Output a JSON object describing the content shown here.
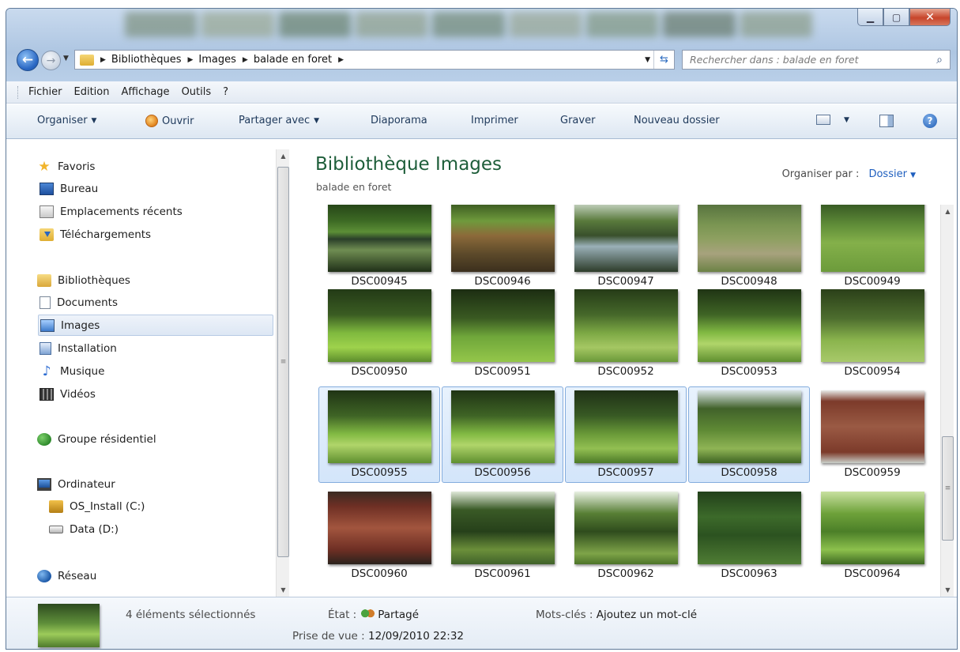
{
  "address": {
    "crumbs": [
      "Bibliothèques",
      "Images",
      "balade en foret"
    ],
    "search_placeholder": "Rechercher dans : balade en foret"
  },
  "menubar": [
    "Fichier",
    "Edition",
    "Affichage",
    "Outils",
    "?"
  ],
  "commandbar": {
    "organiser": "Organiser",
    "ouvrir": "Ouvrir",
    "partager": "Partager avec",
    "diaporama": "Diaporama",
    "imprimer": "Imprimer",
    "graver": "Graver",
    "nouveau_dossier": "Nouveau dossier"
  },
  "navpane": {
    "favoris": "Favoris",
    "bureau": "Bureau",
    "recents": "Emplacements récents",
    "telechargements": "Téléchargements",
    "bibliotheques": "Bibliothèques",
    "documents": "Documents",
    "images": "Images",
    "installation": "Installation",
    "musique": "Musique",
    "videos": "Vidéos",
    "groupe": "Groupe résidentiel",
    "ordinateur": "Ordinateur",
    "os_install": "OS_Install (C:)",
    "data": "Data (D:)",
    "reseau": "Réseau"
  },
  "content": {
    "title": "Bibliothèque Images",
    "subtitle": "balade en foret",
    "arrange_label": "Organiser par :",
    "arrange_value": "Dossier"
  },
  "thumbnails": [
    {
      "name": "DSC00945",
      "selected": false,
      "scene": "pond"
    },
    {
      "name": "DSC00946",
      "selected": false,
      "scene": "pond-brown"
    },
    {
      "name": "DSC00947",
      "selected": false,
      "scene": "pond-bright"
    },
    {
      "name": "DSC00948",
      "selected": false,
      "scene": "meadow-flowers"
    },
    {
      "name": "DSC00949",
      "selected": false,
      "scene": "meadow"
    },
    {
      "name": "DSC00950",
      "selected": false,
      "scene": "forest-grass"
    },
    {
      "name": "DSC00951",
      "selected": false,
      "scene": "forest-grass-dark"
    },
    {
      "name": "DSC00952",
      "selected": false,
      "scene": "forest-path"
    },
    {
      "name": "DSC00953",
      "selected": false,
      "scene": "forest-rock"
    },
    {
      "name": "DSC00954",
      "selected": false,
      "scene": "forest-tall"
    },
    {
      "name": "DSC00955",
      "selected": true,
      "scene": "forest-rock"
    },
    {
      "name": "DSC00956",
      "selected": true,
      "scene": "forest-rock"
    },
    {
      "name": "DSC00957",
      "selected": true,
      "scene": "forest-clearing"
    },
    {
      "name": "DSC00958",
      "selected": true,
      "scene": "forest-sign"
    },
    {
      "name": "DSC00959",
      "selected": false,
      "scene": "board"
    },
    {
      "name": "DSC00960",
      "selected": false,
      "scene": "board-dark"
    },
    {
      "name": "DSC00961",
      "selected": false,
      "scene": "forest-trees"
    },
    {
      "name": "DSC00962",
      "selected": false,
      "scene": "forest-trees-light"
    },
    {
      "name": "DSC00963",
      "selected": false,
      "scene": "forest-sign-green"
    },
    {
      "name": "DSC00964",
      "selected": false,
      "scene": "forest-bright"
    }
  ],
  "status": {
    "selection": "4 éléments sélectionnés",
    "etat_label": "État :",
    "etat_value": "Partagé",
    "prise_label": "Prise de vue :",
    "prise_value": "12/09/2010 22:32",
    "mots_label": "Mots-clés :",
    "mots_value": "Ajoutez un mot-clé"
  },
  "colors": {
    "selection_fill": "#d3e5fa",
    "selection_border": "#84acdd",
    "title_green": "#1e5e3a",
    "link_blue": "#1f5fbf"
  }
}
